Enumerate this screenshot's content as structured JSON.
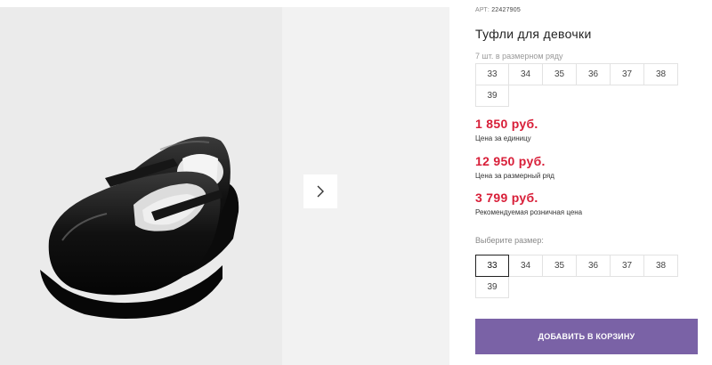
{
  "product": {
    "article_label": "АРТ:",
    "article_value": "22427905",
    "title": "Туфли для девочки",
    "row_note": "7 шт. в размерном ряду",
    "row_sizes": [
      "33",
      "34",
      "35",
      "36",
      "37",
      "38",
      "39"
    ]
  },
  "prices": [
    {
      "value": "1 850 руб.",
      "label": "Цена за единицу"
    },
    {
      "value": "12 950 руб.",
      "label": "Цена за размерный ряд"
    },
    {
      "value": "3 799 руб.",
      "label": "Рекомендуемая розничная цена"
    }
  ],
  "size_select": {
    "label": "Выберите размер:",
    "options": [
      "33",
      "34",
      "35",
      "36",
      "37",
      "38",
      "39"
    ],
    "selected": "33"
  },
  "cart": {
    "button_label": "ДОБАВИТЬ В КОРЗИНУ"
  },
  "gallery": {
    "next_icon": "chevron-right-icon"
  },
  "colors": {
    "price": "#d81e38",
    "accent": "#7a62a6"
  }
}
